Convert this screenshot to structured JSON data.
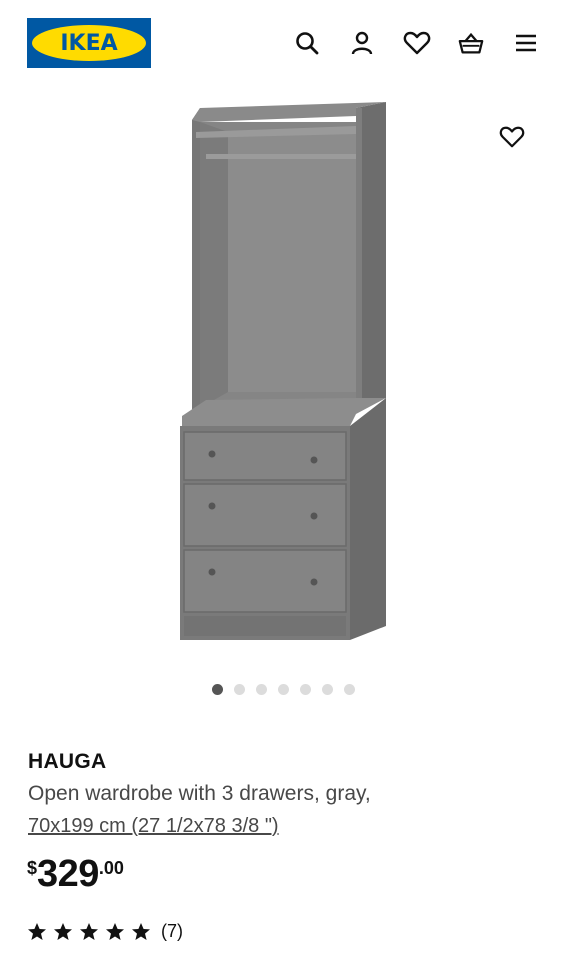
{
  "header": {
    "logo_text": "IKEA",
    "icons": [
      "search-icon",
      "user-icon",
      "heart-icon",
      "basket-icon",
      "menu-icon"
    ]
  },
  "gallery": {
    "image_count": 7,
    "active_index": 0
  },
  "product": {
    "name": "HAUGA",
    "description": "Open wardrobe with 3 drawers, gray,",
    "size": "70x199 cm (27 1/2x78 3/8 \")",
    "price": {
      "currency": "$",
      "integer": "329",
      "decimal": ".00"
    },
    "rating": {
      "stars": 5,
      "count": "(7)"
    }
  },
  "colors": {
    "brand_blue": "#0058a3",
    "brand_yellow": "#ffdb00",
    "furniture_gray": "#7c7c7c"
  }
}
